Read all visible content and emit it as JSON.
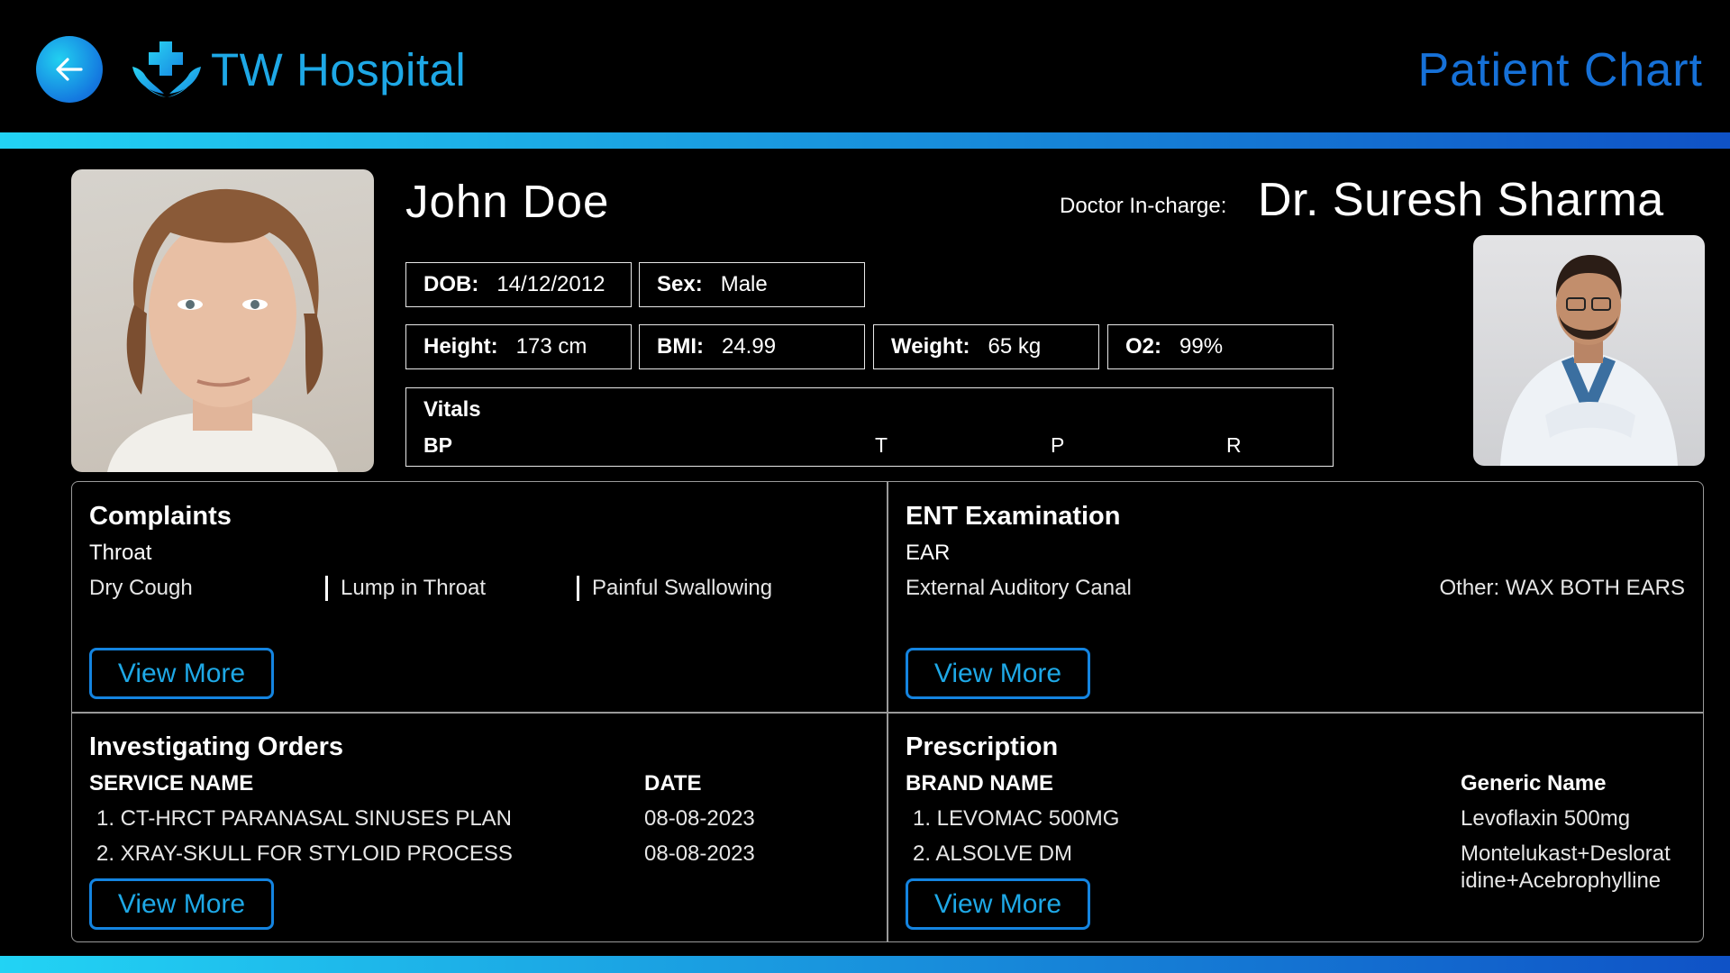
{
  "header": {
    "back_icon": "arrow-left-icon",
    "logo_icon": "medical-cross-hands-icon",
    "hospital_name": "TW Hospital",
    "page_title": "Patient Chart"
  },
  "patient": {
    "name": "John Doe",
    "dob_label": "DOB:",
    "dob": "14/12/2012",
    "sex_label": "Sex:",
    "sex": "Male",
    "height_label": "Height:",
    "height": "173 cm",
    "bmi_label": "BMI:",
    "bmi": "24.99",
    "weight_label": "Weight:",
    "weight": "65 kg",
    "o2_label": "O2:",
    "o2": "99%"
  },
  "doctor": {
    "label": "Doctor In-charge:",
    "name": "Dr. Suresh Sharma"
  },
  "vitals": {
    "title": "Vitals",
    "bp": "BP",
    "t": "T",
    "p": "P",
    "r": "R"
  },
  "complaints": {
    "title": "Complaints",
    "category": "Throat",
    "items": [
      "Dry Cough",
      "Lump in Throat",
      "Painful Swallowing"
    ],
    "button": "View More"
  },
  "ent": {
    "title": "ENT Examination",
    "category": "EAR",
    "finding": "External Auditory Canal",
    "other": "Other: WAX BOTH EARS",
    "button": "View More"
  },
  "orders": {
    "title": "Investigating Orders",
    "col_service": "SERVICE NAME",
    "col_date": "DATE",
    "rows": [
      {
        "service": "1. CT-HRCT PARANASAL SINUSES PLAN",
        "date": "08-08-2023"
      },
      {
        "service": "2. XRAY-SKULL FOR STYLOID PROCESS",
        "date": "08-08-2023"
      }
    ],
    "button": "View More"
  },
  "prescription": {
    "title": "Prescription",
    "col_brand": "BRAND NAME",
    "col_generic": "Generic Name",
    "rows": [
      {
        "brand": "1. LEVOMAC 500MG",
        "generic": "Levoflaxin 500mg"
      },
      {
        "brand": "2. ALSOLVE DM",
        "generic": "Montelukast+Deslorat idine+Acebrophylline"
      }
    ],
    "button": "View More"
  },
  "colors": {
    "accent": "#1ea8e6",
    "accent_dark": "#0f52c6",
    "gradient_start": "#22d3f4",
    "background": "#000000"
  }
}
